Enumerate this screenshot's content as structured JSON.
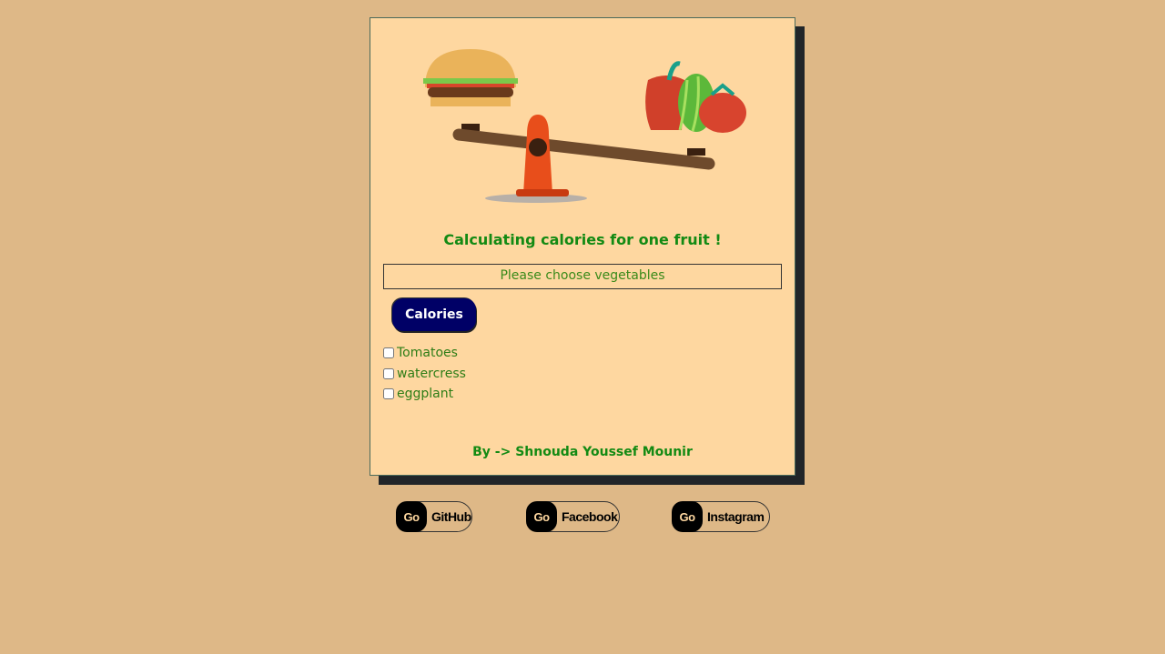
{
  "card": {
    "title": "Calculating calories for one fruit !",
    "result_text": "Please choose vegetables",
    "calories_button": "Calories",
    "options": [
      "Tomatoes",
      "watercress",
      "eggplant"
    ],
    "author": "By -> Shnouda Youssef Mounir"
  },
  "links": [
    {
      "go": "Go",
      "label": "GitHub"
    },
    {
      "go": "Go",
      "label": "Facebook"
    },
    {
      "go": "Go",
      "label": "Instagram"
    }
  ],
  "colors": {
    "page_bg": "#deb887",
    "card_bg": "#fed7a0",
    "accent_green": "#138a13",
    "button_bg": "#000066"
  }
}
